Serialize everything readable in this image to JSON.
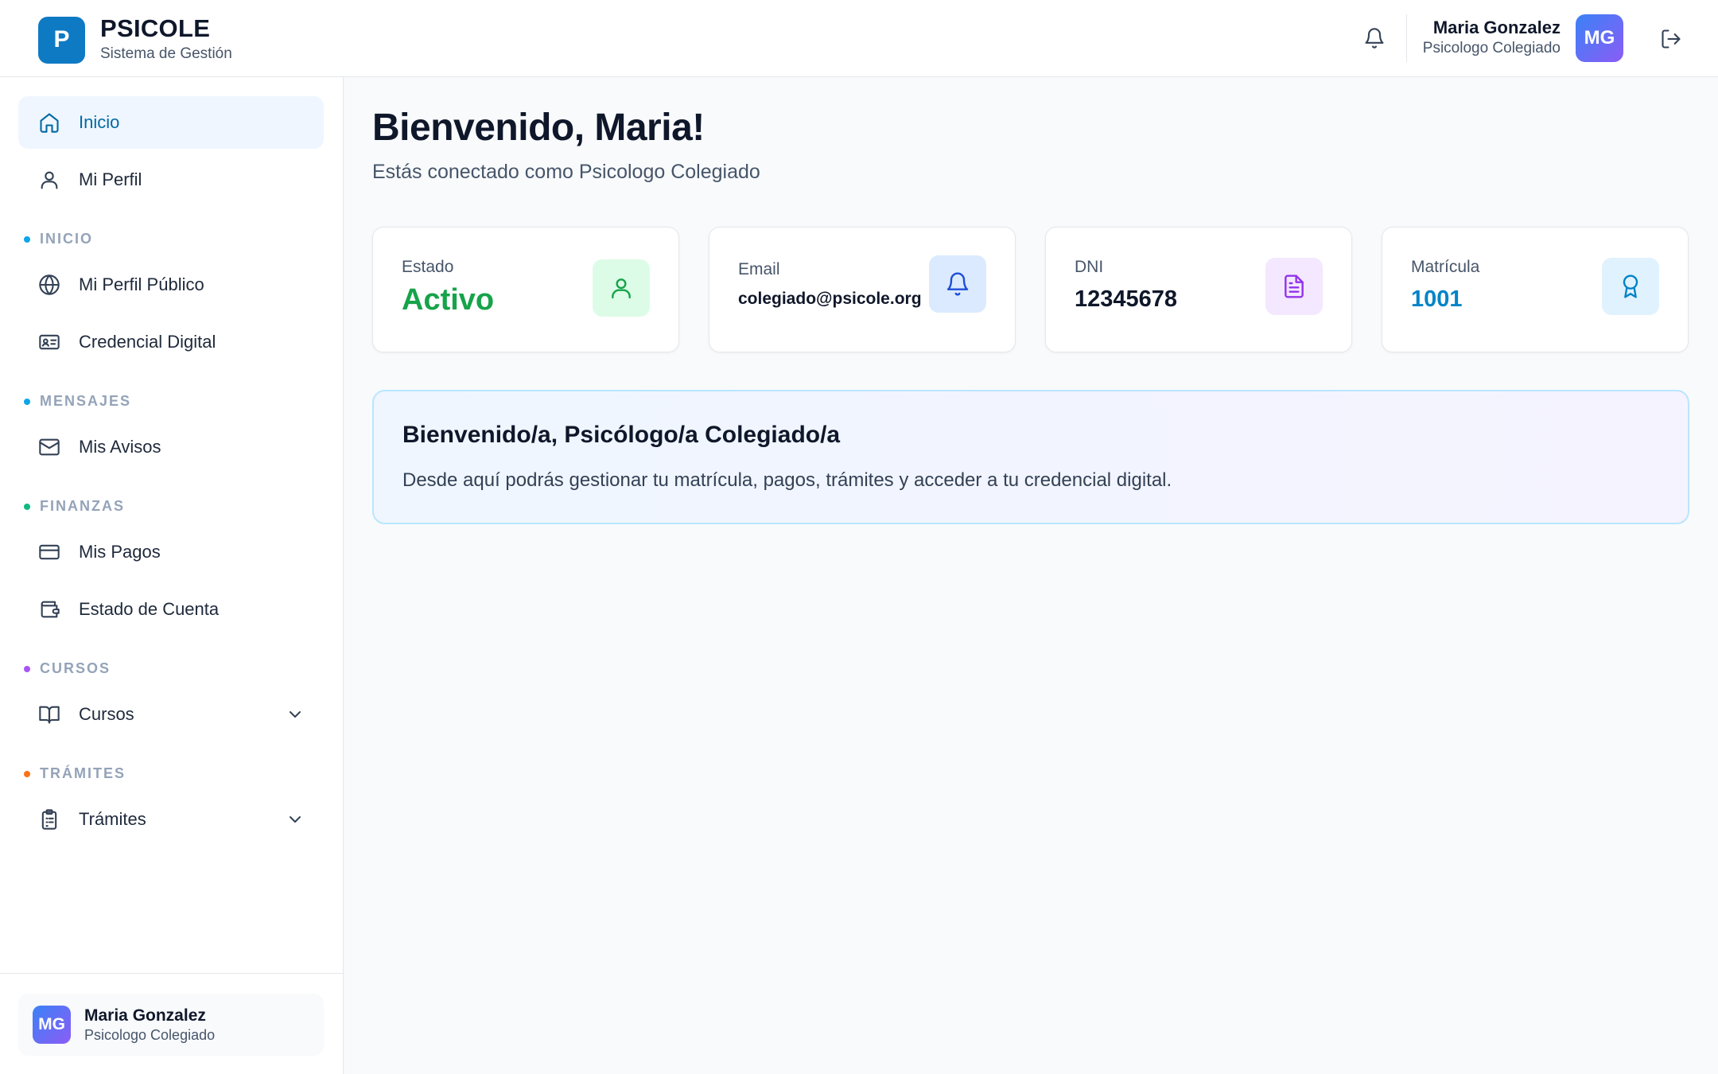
{
  "header": {
    "logo_letter": "P",
    "brand_title": "PSICOLE",
    "brand_subtitle": "Sistema de Gestión",
    "user_name": "Maria Gonzalez",
    "user_role": "Psicologo Colegiado",
    "user_initials": "MG"
  },
  "sidebar": {
    "items": [
      {
        "label": "Inicio",
        "icon": "home-icon",
        "active": true
      },
      {
        "label": "Mi Perfil",
        "icon": "user-icon"
      },
      {
        "label": "Mi Perfil Público",
        "icon": "globe-icon"
      },
      {
        "label": "Credencial Digital",
        "icon": "id-card-icon"
      },
      {
        "label": "Mis Avisos",
        "icon": "mail-icon"
      },
      {
        "label": "Mis Pagos",
        "icon": "credit-card-icon"
      },
      {
        "label": "Estado de Cuenta",
        "icon": "wallet-icon"
      },
      {
        "label": "Cursos",
        "icon": "book-icon",
        "expandable": true
      },
      {
        "label": "Trámites",
        "icon": "clipboard-icon",
        "expandable": true
      }
    ],
    "sections": [
      {
        "label": "INICIO",
        "color": "#0ea5e9"
      },
      {
        "label": "MENSAJES",
        "color": "#0ea5e9"
      },
      {
        "label": "FINANZAS",
        "color": "#10b981"
      },
      {
        "label": "CURSOS",
        "color": "#a855f7"
      },
      {
        "label": "TRÁMITES",
        "color": "#f97316"
      }
    ],
    "footer": {
      "initials": "MG",
      "name": "Maria Gonzalez",
      "role": "Psicologo Colegiado"
    }
  },
  "main": {
    "title": "Bienvenido, Maria!",
    "subtitle": "Estás conectado como Psicologo Colegiado",
    "stats": [
      {
        "label": "Estado",
        "value": "Activo",
        "value_color": "#16a34a",
        "icon": "user-icon",
        "icon_bg": "#dcfce7",
        "icon_color": "#16a34a"
      },
      {
        "label": "Email",
        "value": "colegiado@psicole.org",
        "icon": "bell-icon",
        "icon_bg": "#dbeafe",
        "icon_color": "#1d4ed8"
      },
      {
        "label": "DNI",
        "value": "12345678",
        "icon": "file-text-icon",
        "icon_bg": "#f3e8ff",
        "icon_color": "#9333ea"
      },
      {
        "label": "Matrícula",
        "value": "1001",
        "value_color": "#0284c7",
        "icon": "award-icon",
        "icon_bg": "#e0f2fe",
        "icon_color": "#0284c7"
      }
    ],
    "banner": {
      "title": "Bienvenido/a, Psicólogo/a Colegiado/a",
      "text": "Desde aquí podrás gestionar tu matrícula, pagos, trámites y acceder a tu credencial digital."
    }
  },
  "colors": {
    "brand": "#0f7ac4",
    "active_nav_bg": "#eff6ff",
    "active_nav_text": "#0369a1"
  }
}
